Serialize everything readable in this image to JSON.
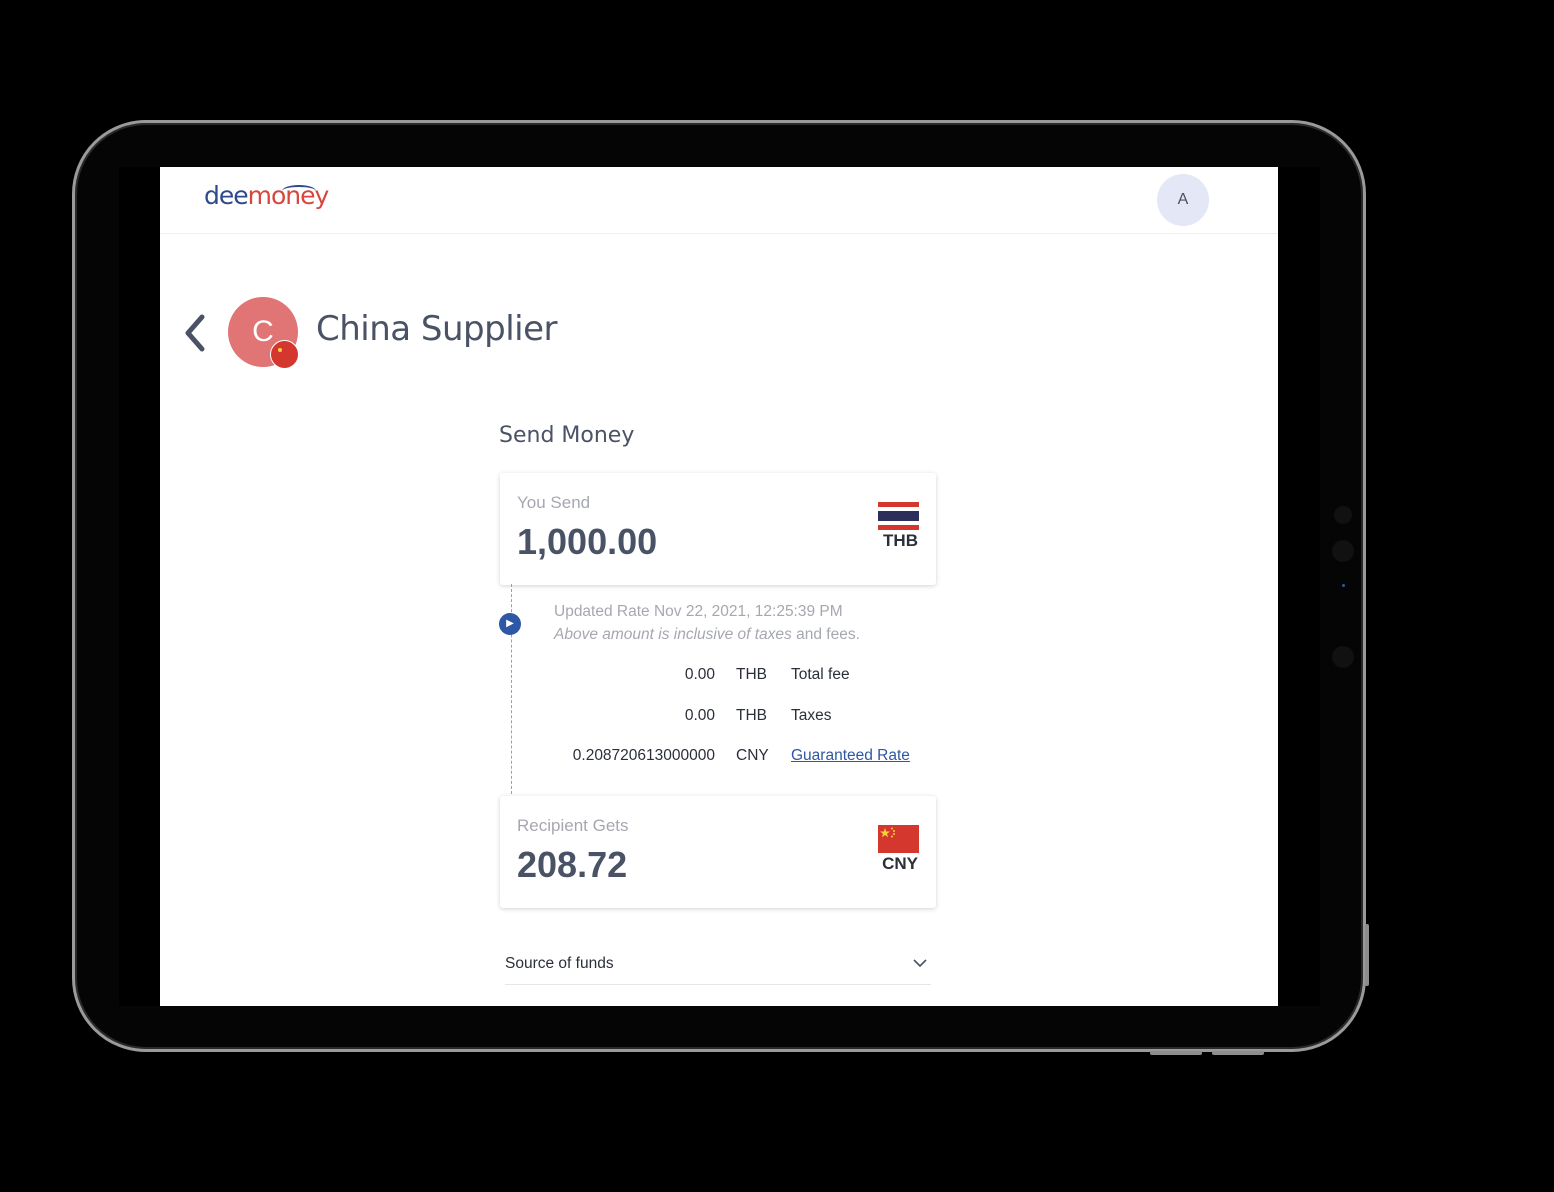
{
  "header": {
    "logo_part1": "dee",
    "logo_part2": "money",
    "user_initial": "A"
  },
  "recipient": {
    "initial": "C",
    "name": "China Supplier"
  },
  "send_money": {
    "title": "Send Money",
    "you_send": {
      "label": "You Send",
      "amount": "1,000.00",
      "currency": "THB"
    },
    "rate_info": {
      "updated_text": "Updated Rate Nov 22, 2021, 12:25:39 PM",
      "note_italic": "Above amount is inclusive of taxes",
      "note_rest": " and fees."
    },
    "fees": [
      {
        "value": "0.00",
        "currency": "THB",
        "name": "Total fee"
      },
      {
        "value": "0.00",
        "currency": "THB",
        "name": "Taxes"
      },
      {
        "value": "0.208720613000000",
        "currency": "CNY",
        "name": "Guaranteed Rate"
      }
    ],
    "recipient_gets": {
      "label": "Recipient Gets",
      "amount": "208.72",
      "currency": "CNY"
    },
    "source_of_funds": {
      "label": "Source of funds"
    }
  },
  "colors": {
    "brand_blue": "#2e4a8c",
    "brand_red": "#d6473d",
    "text_dark": "#4a5266",
    "link": "#2e57a6"
  }
}
